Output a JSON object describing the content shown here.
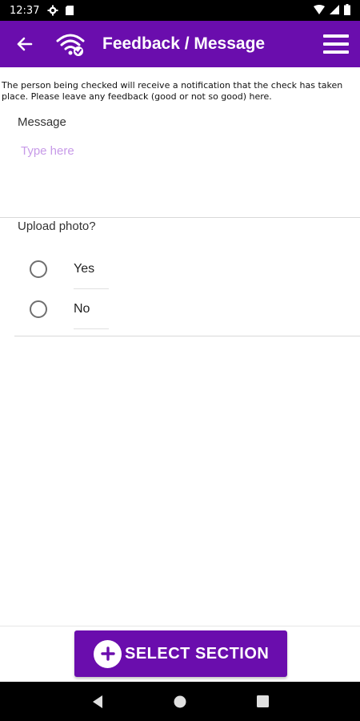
{
  "status_bar": {
    "time": "12:37"
  },
  "app_bar": {
    "title": "Feedback / Message"
  },
  "notice": "The person being checked will receive a notification that the check has taken place. Please leave any feedback (good or not so good) here.",
  "message": {
    "label": "Message",
    "placeholder": "Type here",
    "value": ""
  },
  "upload": {
    "label": "Upload photo?",
    "options": [
      {
        "label": "Yes",
        "selected": false
      },
      {
        "label": "No",
        "selected": false
      }
    ]
  },
  "select_button": {
    "label": "SELECT SECTION"
  },
  "colors": {
    "primary": "#6a0dad",
    "placeholder": "#c79ae8"
  }
}
